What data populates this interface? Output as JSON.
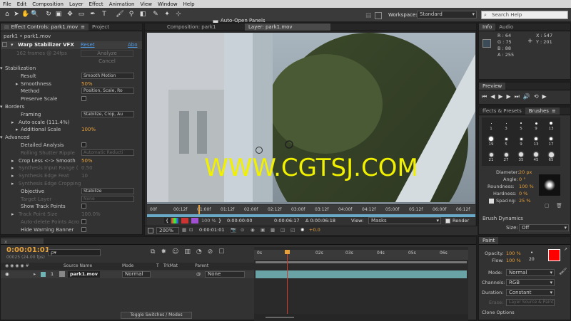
{
  "menu": [
    "File",
    "Edit",
    "Composition",
    "Layer",
    "Effect",
    "Animation",
    "View",
    "Window",
    "Help"
  ],
  "toolbar": {
    "auto_open": "Auto-Open Panels",
    "workspace_label": "Workspace:",
    "workspace_value": "Standard",
    "search_placeholder": "Search Help"
  },
  "left_panel": {
    "tab1": "Effect Controls: park1.mov",
    "tab2": "Project",
    "breadcrumb": "park1 • park1.mov",
    "effect_name": "Warp Stabilizer VFX",
    "reset": "Reset",
    "about": "Abo",
    "frames_info": "162 frames @ 24fps",
    "analyze": "Analyze",
    "cancel": "Cancel",
    "rows": [
      {
        "label": "Stabilization",
        "indent": 0,
        "tw": "v"
      },
      {
        "label": "Result",
        "indent": 2,
        "select": "Smooth Motion"
      },
      {
        "label": "Smoothness",
        "indent": 2,
        "tw": ">",
        "value": "50%",
        "vclass": "orange"
      },
      {
        "label": "Method",
        "indent": 2,
        "select": "Position, Scale, Ro"
      },
      {
        "label": "Preserve Scale",
        "indent": 2,
        "check": true
      },
      {
        "label": "Borders",
        "indent": 0,
        "tw": "v"
      },
      {
        "label": "Framing",
        "indent": 2,
        "select": "Stabilize, Crop, Au"
      },
      {
        "label": "Auto-scale (111.4%)",
        "indent": 1,
        "tw": ">"
      },
      {
        "label": "Additional Scale",
        "indent": 2,
        "tw": ">",
        "value": "100%",
        "vclass": "orange"
      },
      {
        "label": "Advanced",
        "indent": 0,
        "tw": "v"
      },
      {
        "label": "Detailed Analysis",
        "indent": 2,
        "check": true
      },
      {
        "label": "Rolling Shutter Ripple",
        "indent": 2,
        "dim": true,
        "select": "Automatic Reducti"
      },
      {
        "label": "Crop Less <-> Smooth",
        "indent": 1,
        "tw": ">",
        "value": "50%",
        "vclass": "orange"
      },
      {
        "label": "Synthesis Input Range (",
        "indent": 1,
        "dim": true,
        "tw": ">",
        "value": "0.50"
      },
      {
        "label": "Synthesis Edge Feat",
        "indent": 1,
        "dim": true,
        "tw": ">",
        "value": "10"
      },
      {
        "label": "Synthesis Edge Cropping",
        "indent": 1,
        "dim": true,
        "tw": ">"
      },
      {
        "label": "Objective",
        "indent": 2,
        "select": "Stabilize"
      },
      {
        "label": "Target Layer",
        "indent": 2,
        "dim": true,
        "select": "None"
      },
      {
        "label": "Show Track Points",
        "indent": 2,
        "check": true
      },
      {
        "label": "Track Point Size",
        "indent": 1,
        "dim": true,
        "tw": ">",
        "value": "100.0%"
      },
      {
        "label": "Auto-delete Points Acro",
        "indent": 2,
        "dim": true,
        "check": true
      },
      {
        "label": "Hide Warning Banner",
        "indent": 2,
        "check": true
      }
    ]
  },
  "viewer": {
    "tab1": "Composition: park1",
    "tab2": "Layer: park1.mov",
    "watermark": "WWW.CGTSJ.COM",
    "ruler": [
      "00f",
      "00:12f",
      "01:00f",
      "01:12f",
      "02:00f",
      "02:12f",
      "03:00f",
      "03:12f",
      "04:00f",
      "04:12f",
      "05:00f",
      "05:12f",
      "06:00f",
      "06:12f"
    ],
    "controls": {
      "in": "0:00:00:00",
      "out": "0:00:06:17",
      "dur": "Δ 0:00:06:18",
      "view_label": "View:",
      "view_value": "Masks",
      "render": "Render"
    },
    "bottom": {
      "zoom": "200%",
      "timecode": "0:00:01:01",
      "exposure": "+0.0",
      "percent": "100 %"
    }
  },
  "info": {
    "tab1": "Info",
    "tab2": "Audio",
    "r": "R : 64",
    "g": "G : 75",
    "b": "B : 88",
    "a": "A : 255",
    "x": "X : 547",
    "y": "Y : 201",
    "swatch": "#3c4b58"
  },
  "preview": {
    "title": "Preview"
  },
  "brushes": {
    "tab1": "ffects & Presets",
    "tab2": "Brushes",
    "sizes": [
      "1",
      "3",
      "5",
      "9",
      "13",
      "19",
      "5",
      "9",
      "13",
      "17",
      "21",
      "27",
      "35",
      "45",
      "65"
    ],
    "diameter_label": "Diameter:",
    "diameter": "20 px",
    "angle_label": "Angle:",
    "angle": "0 °",
    "roundness_label": "Roundness:",
    "roundness": "100 %",
    "hardness_label": "Hardness:",
    "hardness": "0 %",
    "spacing_label": "Spacing:",
    "spacing": "25 %",
    "dynamics": "Brush Dynamics",
    "size_label": "Size:",
    "size_value": "Off"
  },
  "timeline": {
    "time": "0:00:01:01",
    "fps": "00025 (24.00 fps)",
    "search_placeholder": "ρ▾",
    "cols": {
      "source": "Source Name",
      "mode": "Mode",
      "t": "T",
      "trkmat": "TrkMat",
      "parent": "Parent"
    },
    "layer": {
      "num": "1",
      "name": "park1.mov",
      "mode": "Normal",
      "parent": "None"
    },
    "ruler": [
      "0s",
      "02s",
      "03s",
      "04s",
      "05s",
      "06s"
    ],
    "toggle": "Toggle Switches / Modes"
  },
  "paint": {
    "title": "Paint",
    "opacity_label": "Opacity:",
    "opacity": "100 %",
    "flow_label": "Flow:",
    "flow": "100 %",
    "brush_size": "20",
    "mode_label": "Mode:",
    "mode": "Normal",
    "channels_label": "Channels:",
    "channels": "RGB",
    "duration_label": "Duration:",
    "duration": "Constant",
    "erase_label": "Erase:",
    "erase": "Layer Source & Paint",
    "clone": "Clone Options",
    "fg": "#ff0000"
  }
}
